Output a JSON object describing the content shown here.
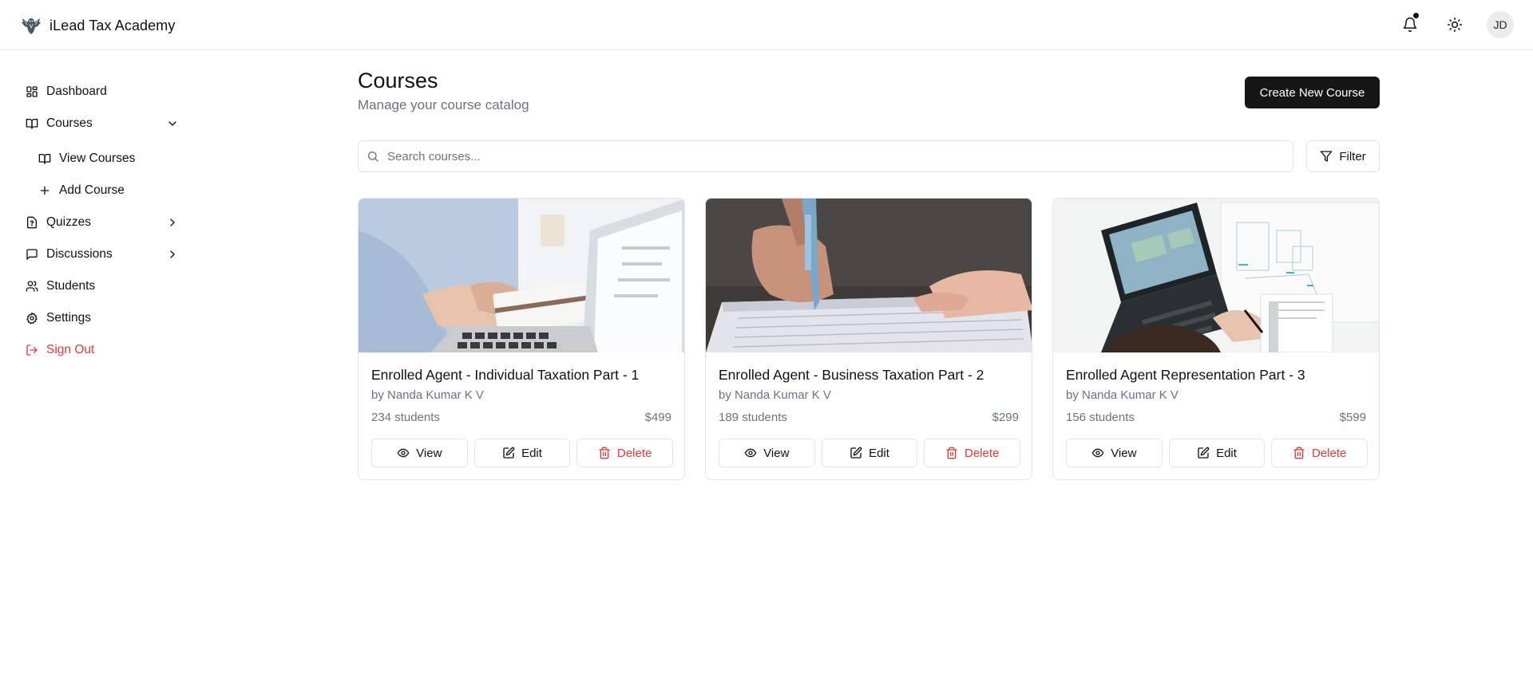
{
  "app": {
    "name": "iLead Tax Academy"
  },
  "header": {
    "avatar_initials": "JD"
  },
  "sidebar": {
    "items": [
      {
        "label": "Dashboard",
        "icon": "grid-icon"
      },
      {
        "label": "Courses",
        "icon": "book-icon",
        "expanded": true
      },
      {
        "label": "View Courses",
        "icon": "book-icon"
      },
      {
        "label": "Add Course",
        "icon": "plus-icon"
      },
      {
        "label": "Quizzes",
        "icon": "file-question-icon"
      },
      {
        "label": "Discussions",
        "icon": "message-square-icon"
      },
      {
        "label": "Students",
        "icon": "users-icon"
      },
      {
        "label": "Settings",
        "icon": "gear-icon"
      },
      {
        "label": "Sign Out",
        "icon": "sign-out-icon"
      }
    ]
  },
  "main": {
    "title": "Courses",
    "subtitle": "Manage your course catalog",
    "create_button": "Create New Course",
    "search_placeholder": "Search courses...",
    "filter_button": "Filter"
  },
  "courses": [
    {
      "title": "Enrolled Agent - Individual Taxation Part - 1",
      "author": "by Nanda Kumar K V",
      "students": "234 students",
      "price": "$499"
    },
    {
      "title": "Enrolled Agent - Business Taxation Part - 2",
      "author": "by Nanda Kumar K V",
      "students": "189 students",
      "price": "$299"
    },
    {
      "title": "Enrolled Agent Representation Part - 3",
      "author": "by Nanda Kumar K V",
      "students": "156 students",
      "price": "$599"
    }
  ],
  "card_actions": {
    "view": "View",
    "edit": "Edit",
    "delete": "Delete"
  },
  "colors": {
    "primary_button": "#161616",
    "danger": "#e53935",
    "muted_text": "#6b7280",
    "border": "#e2e4e8"
  }
}
